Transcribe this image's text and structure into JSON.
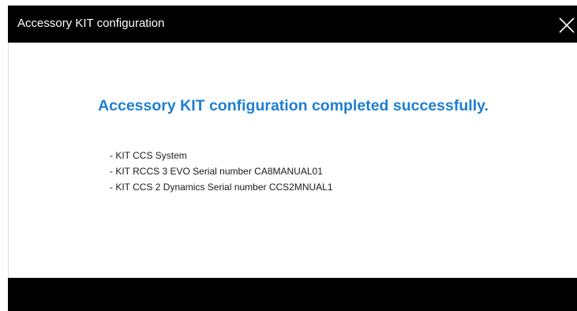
{
  "window": {
    "title": "Accessory KIT configuration",
    "close_icon": "close-icon"
  },
  "main": {
    "heading": "Accessory KIT configuration completed successfully.",
    "items": [
      "- KIT CCS System",
      "- KIT RCCS 3 EVO Serial number CA8MANUAL01",
      "- KIT CCS 2 Dynamics Serial number CCS2MNUAL1"
    ]
  },
  "colors": {
    "title_bar": "#000000",
    "heading": "#1f7fd1",
    "footer_bar": "#000000",
    "background": "#ffffff"
  }
}
